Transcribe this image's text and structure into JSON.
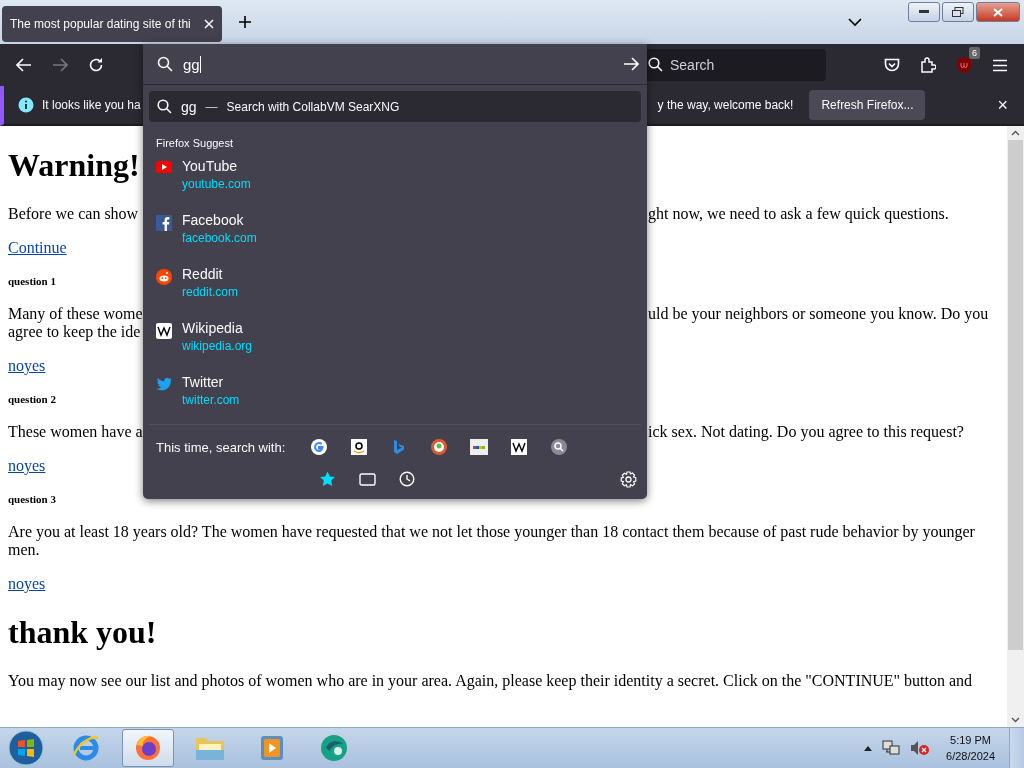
{
  "tabs": [
    {
      "title": "The most popular dating site of thi",
      "selected": true
    }
  ],
  "toolbar": {
    "back_disabled": false,
    "forward_disabled": true,
    "search_placeholder": "Search",
    "badge": "6"
  },
  "notification": {
    "text_left": "It looks like you ha",
    "text_right": "y the way, welcome back!",
    "button": "Refresh Firefox...",
    "close": "×"
  },
  "urlbar": {
    "value": "gg",
    "search_row": {
      "query": "gg",
      "separator": "—",
      "action": "Search with CollabVM SearXNG",
      "selected": true
    },
    "group_label": "Firefox Suggest",
    "suggestions": [
      {
        "title": "YouTube",
        "url": "youtube.com",
        "selected": false
      },
      {
        "title": "Facebook",
        "url": "facebook.com",
        "selected": false
      },
      {
        "title": "Reddit",
        "url": "reddit.com",
        "selected": false
      },
      {
        "title": "Wikipedia",
        "url": "wikipedia.org",
        "selected": false
      },
      {
        "title": "Twitter",
        "url": "twitter.com",
        "selected": false
      }
    ],
    "search_with_label": "This time, search with:"
  },
  "content": [
    {
      "kind": "heading",
      "text": "Warning!"
    },
    {
      "kind": "split",
      "lines": [
        {
          "left": "Before we can show",
          "right": "ght now, we need to ask a few quick questions."
        }
      ]
    },
    {
      "kind": "link",
      "text": "Continue"
    },
    {
      "kind": "subheading",
      "text": "question 1"
    },
    {
      "kind": "split",
      "lines": [
        {
          "left": "Many of these wome",
          "right": "uld be your neighbors or someone you know. Do you"
        },
        {
          "left": "agree to keep the ide"
        }
      ]
    },
    {
      "kind": "answers",
      "links": [
        "no",
        "yes"
      ]
    },
    {
      "kind": "subheading",
      "text": "question 2"
    },
    {
      "kind": "split",
      "lines": [
        {
          "left": "These women have a",
          "right": "ick sex. Not dating. Do you agree to this request?"
        }
      ]
    },
    {
      "kind": "answers",
      "links": [
        "no",
        "yes"
      ]
    },
    {
      "kind": "subheading",
      "text": "question 3"
    },
    {
      "kind": "paragraph",
      "text": "Are you at least 18 years old? The women have requested that we not let those younger than 18 contact them because of past rude behavior by younger men."
    },
    {
      "kind": "answers",
      "links": [
        "no",
        "yes"
      ]
    },
    {
      "kind": "heading",
      "text": "thank you!"
    },
    {
      "kind": "paragraph",
      "text": "You may now see our list and photos of women who are in your area. Again, please keep their identity a secret. Click on the \"CONTINUE\" button and"
    }
  ],
  "taskbar": {
    "apps": [
      {
        "selected": false
      },
      {
        "selected": true
      },
      {
        "selected": false
      },
      {
        "selected": false
      },
      {
        "selected": false
      }
    ],
    "time": "5:19 PM",
    "date": "6/28/2024"
  }
}
